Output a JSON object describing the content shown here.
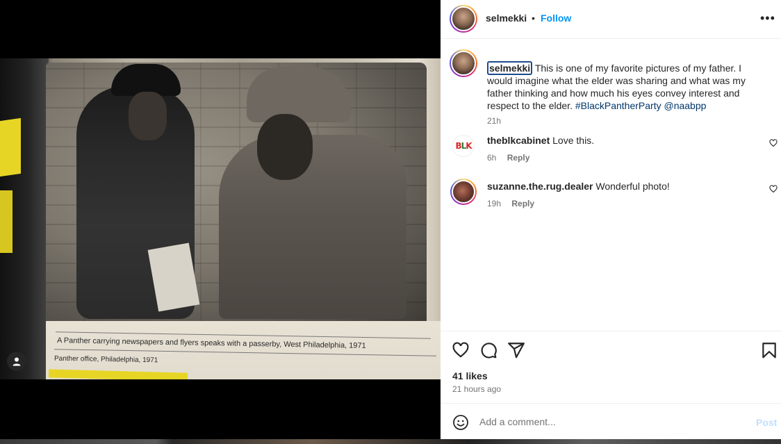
{
  "header": {
    "username": "selmekki",
    "separator": "•",
    "follow_label": "Follow",
    "more_icon": "more-horizontal-icon"
  },
  "photo": {
    "caption_line1": "A Panther carrying newspapers and flyers speaks with a passerby, West Philadelphia, 1971",
    "caption_line2": "Panther office, Philadelphia, 1971"
  },
  "post_caption": {
    "username": "selmekki",
    "text": "This is one of my favorite pictures of my father. I would imagine what the elder was sharing and what was my father thinking and how much his eyes convey interest and respect to the elder.",
    "hashtag": "#BlackPantherParty",
    "mention": "@naabpp",
    "time": "21h"
  },
  "comments": [
    {
      "username": "theblkcabinet",
      "text": "Love this.",
      "time": "6h",
      "reply_label": "Reply"
    },
    {
      "username": "suzanne.the.rug.dealer",
      "text": "Wonderful photo!",
      "time": "19h",
      "reply_label": "Reply"
    }
  ],
  "actions": {
    "likes": "41 likes",
    "posted": "21 hours ago",
    "icons": [
      "heart-icon",
      "comment-icon",
      "share-icon",
      "save-icon"
    ]
  },
  "add_comment": {
    "placeholder": "Add a comment...",
    "post_label": "Post"
  },
  "colors": {
    "link_blue": "#0095f6",
    "hashtag_blue": "#00376b",
    "muted": "#737373",
    "post_disabled": "#c0dffd"
  }
}
